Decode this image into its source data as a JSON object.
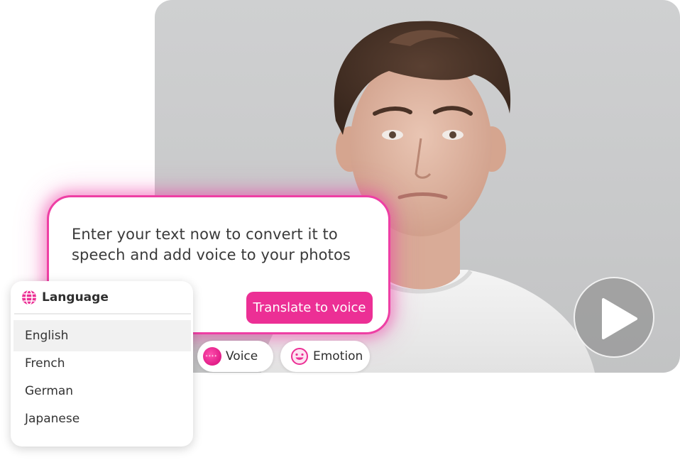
{
  "theme": {
    "accent": "#ec2f95",
    "glow": "#ee3fa4"
  },
  "photo": {
    "play_icon": "play-icon"
  },
  "editor": {
    "prompt_line1": "Enter your text now to convert it to",
    "prompt_line2": "speech and add voice to your photos",
    "translate_button": "Translate to voice"
  },
  "chips": {
    "voice_label": "Voice",
    "emotion_label": "Emotion",
    "voice_icon": "voice-avatar-icon",
    "emotion_icon": "smiley-icon"
  },
  "language": {
    "title": "Language",
    "icon": "globe-icon",
    "options": [
      {
        "label": "English",
        "selected": true
      },
      {
        "label": "French",
        "selected": false
      },
      {
        "label": "German",
        "selected": false
      },
      {
        "label": "Japanese",
        "selected": false
      }
    ]
  }
}
